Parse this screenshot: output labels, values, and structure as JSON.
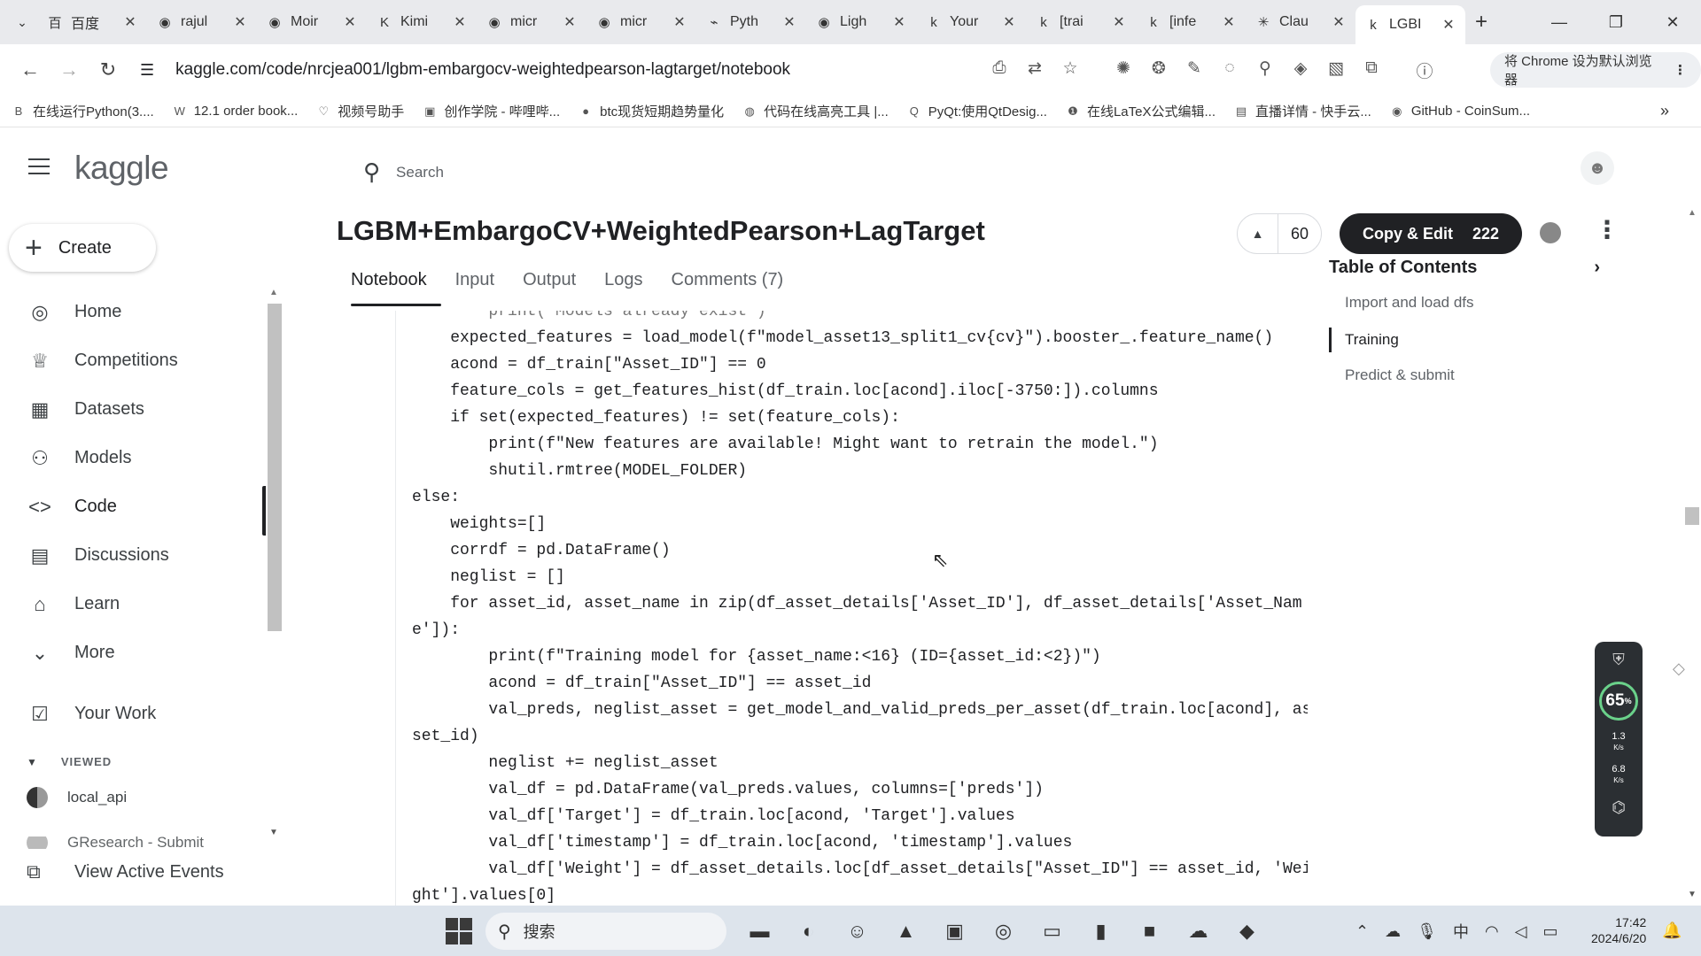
{
  "browser": {
    "tabs": [
      {
        "icon": "百",
        "title": "百度"
      },
      {
        "icon": "◉",
        "title": "rajul"
      },
      {
        "icon": "◉",
        "title": "Moir"
      },
      {
        "icon": "K",
        "title": "Kimi"
      },
      {
        "icon": "◉",
        "title": "micr"
      },
      {
        "icon": "◉",
        "title": "micr"
      },
      {
        "icon": "⌁",
        "title": "Pyth"
      },
      {
        "icon": "◉",
        "title": "Ligh"
      },
      {
        "icon": "k",
        "title": "Your"
      },
      {
        "icon": "k",
        "title": "[trai"
      },
      {
        "icon": "k",
        "title": "[infe"
      },
      {
        "icon": "✳",
        "title": "Clau"
      },
      {
        "icon": "k",
        "title": "LGBI"
      }
    ],
    "url": "kaggle.com/code/nrcjea001/lgbm-embargocv-weightedpearson-lagtarget/notebook",
    "default_browser_label": "将 Chrome 设为默认浏览器",
    "bookmarks": [
      {
        "icon": "B",
        "label": "在线运行Python(3...."
      },
      {
        "icon": "W",
        "label": "12.1 order book..."
      },
      {
        "icon": "♡",
        "label": "视频号助手"
      },
      {
        "icon": "▣",
        "label": "创作学院 - 哔哩哔..."
      },
      {
        "icon": "●",
        "label": "btc现货短期趋势量化"
      },
      {
        "icon": "◍",
        "label": "代码在线高亮工具 |..."
      },
      {
        "icon": "Q",
        "label": "PyQt:使用QtDesig..."
      },
      {
        "icon": "❶",
        "label": "在线LaTeX公式编辑..."
      },
      {
        "icon": "▤",
        "label": "直播详情 - 快手云..."
      },
      {
        "icon": "◉",
        "label": "GitHub - CoinSum..."
      }
    ]
  },
  "kaggle": {
    "logo": "kaggle",
    "create_label": "Create",
    "nav": [
      {
        "name": "home",
        "icon": "◎",
        "label": "Home"
      },
      {
        "name": "competitions",
        "icon": "♕",
        "label": "Competitions"
      },
      {
        "name": "datasets",
        "icon": "▦",
        "label": "Datasets"
      },
      {
        "name": "models",
        "icon": "⚇",
        "label": "Models"
      },
      {
        "name": "code",
        "icon": "<>",
        "label": "Code"
      },
      {
        "name": "discussions",
        "icon": "▤",
        "label": "Discussions"
      },
      {
        "name": "learn",
        "icon": "⌂",
        "label": "Learn"
      },
      {
        "name": "more",
        "icon": "⌄",
        "label": "More"
      }
    ],
    "your_work": "Your Work",
    "viewed_header": "VIEWED",
    "viewed_items": [
      "local_api",
      "GResearch - Submit"
    ],
    "view_active_events": "View Active Events",
    "search_placeholder": "Search",
    "notebook_title": "LGBM+EmbargoCV+WeightedPearson+LagTarget",
    "upvotes": "60",
    "copy_edit_label": "Copy & Edit",
    "copy_edit_count": "222",
    "tabs": [
      "Notebook",
      "Input",
      "Output",
      "Logs",
      "Comments (7)"
    ],
    "toc": {
      "title": "Table of Contents",
      "items": [
        "Import and load dfs",
        "Training",
        "Predict & submit"
      ]
    },
    "code_lines": [
      "        print(\"Models already exist\")",
      "    expected_features = load_model(f\"model_asset13_split1_cv{cv}\").booster_.feature_name()",
      "    acond = df_train[\"Asset_ID\"] == 0",
      "    feature_cols = get_features_hist(df_train.loc[acond].iloc[-3750:]).columns",
      "    if set(expected_features) != set(feature_cols):",
      "        print(f\"New features are available! Might want to retrain the model.\")",
      "        shutil.rmtree(MODEL_FOLDER)",
      "else:",
      "    weights=[]",
      "    corrdf = pd.DataFrame()",
      "    neglist = []",
      "    for asset_id, asset_name in zip(df_asset_details['Asset_ID'], df_asset_details['Asset_Nam",
      "e']):",
      "        print(f\"Training model for {asset_name:<16} (ID={asset_id:<2})\")",
      "        acond = df_train[\"Asset_ID\"] == asset_id",
      "        val_preds, neglist_asset = get_model_and_valid_preds_per_asset(df_train.loc[acond], as",
      "set_id)",
      "        neglist += neglist_asset",
      "        val_df = pd.DataFrame(val_preds.values, columns=['preds'])",
      "        val_df['Target'] = df_train.loc[acond, 'Target'].values",
      "        val_df['timestamp'] = df_train.loc[acond, 'timestamp'].values",
      "        val_df['Weight'] = df_asset_details.loc[df_asset_details[\"Asset_ID\"] == asset_id, 'Wei",
      "ght'].values[0]"
    ]
  },
  "widget": {
    "percent": "65",
    "percent_suffix": "%",
    "up": "1.3",
    "down": "6.8",
    "unit": "K/s"
  },
  "taskbar": {
    "search_label": "搜索",
    "tray_ime": "中",
    "time": "17:42",
    "date": "2024/6/20"
  }
}
